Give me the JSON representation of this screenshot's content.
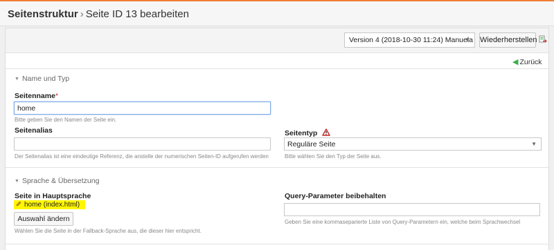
{
  "breadcrumb": {
    "root": "Seitenstruktur",
    "separator": "›",
    "current": "Seite ID 13 bearbeiten"
  },
  "toolbar": {
    "version_selected": "Version 4 (2018-10-30 11:24) Manuela",
    "restore_label": "Wiederherstellen"
  },
  "back_label": "Zurück",
  "sections": {
    "name_type": {
      "title": "Name und Typ",
      "page_name_label": "Seitenname",
      "required_mark": "*",
      "page_name_value": "home",
      "page_name_hint": "Bitte geben Sie den Namen der Seite ein.",
      "alias_label": "Seitenalias",
      "alias_value": "",
      "alias_hint": "Der Seitenalias ist eine eindeutige Referenz, die anstelle der numerischen Seiten-ID aufgerufen werden",
      "type_label": "Seitentyp",
      "type_value": "Reguläre Seite",
      "type_hint": "Bitte wählen Sie den Typ der Seite aus."
    },
    "language": {
      "title": "Sprache & Übersetzung",
      "main_lang_label": "Seite in Hauptsprache",
      "main_lang_page": "home (index.html)",
      "choose_label": "Auswahl ändern",
      "choose_hint": "Wählen Sie die Seite in der Fallback-Sprache aus, die dieser hier entspricht.",
      "query_label": "Query-Parameter beibehalten",
      "query_value": "",
      "query_hint": "Geben Sie eine kommaseparierte Liste von Query-Parametern ein, welche beim Sprachwechsel"
    }
  },
  "colors": {
    "accent": "#f07d32",
    "highlight": "#fff600",
    "focus": "#7fa8e0",
    "back_arrow": "#3cae4a"
  }
}
